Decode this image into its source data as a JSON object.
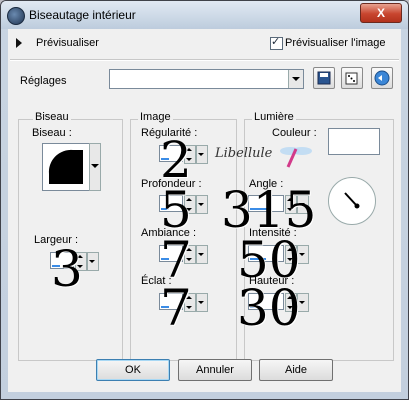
{
  "window": {
    "title": "Biseautage intérieur",
    "close_label": "X"
  },
  "preview": {
    "label": "Prévisualiser",
    "preview_image_label": "Prévisualiser l'image",
    "preview_image_checked": true
  },
  "settings": {
    "label": "Réglages",
    "value": ""
  },
  "groups": {
    "bevel": {
      "title": "Biseau",
      "bevel_label": "Biseau :",
      "width_label": "Largeur :",
      "width_value": "3"
    },
    "image": {
      "title": "Image",
      "smoothness_label": "Régularité :",
      "smoothness_value": "2",
      "depth_label": "Profondeur :",
      "depth_value": "5",
      "ambience_label": "Ambiance :",
      "ambience_value": "7",
      "shininess_label": "Éclat :",
      "shininess_value": "7"
    },
    "light": {
      "title": "Lumière",
      "color_label": "Couleur :",
      "angle_label": "Angle :",
      "angle_value": "315",
      "intensity_label": "Intensité :",
      "intensity_value": "50",
      "elevation_label": "Hauteur :",
      "elevation_value": "30"
    }
  },
  "watermark": "Libellule",
  "buttons": {
    "ok": "OK",
    "cancel": "Annuler",
    "help": "Aide"
  }
}
